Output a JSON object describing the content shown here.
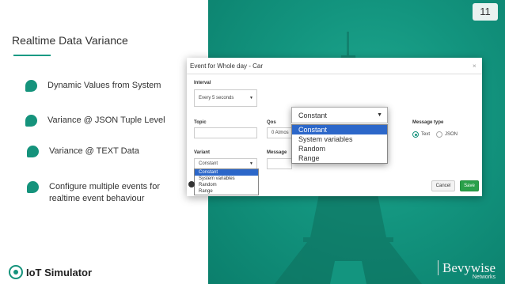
{
  "slide_number": "11",
  "title": "Realtime Data Variance",
  "bullets": [
    "Dynamic Values from System",
    "Variance @ JSON Tuple Level",
    "Variance @ TEXT Data",
    "Configure multiple events for",
    "realtime event behaviour"
  ],
  "footer": {
    "logo_text": "IoT Simulator",
    "brand_name": "Bevywise",
    "brand_sub": "Networks"
  },
  "modal": {
    "title": "Event for Whole day - Car",
    "close": "×",
    "interval_label": "Interval",
    "interval_value": "Every 5 seconds",
    "topic_label": "Topic",
    "qos_label": "Qos",
    "qos_value": "0 Atmos",
    "message_type_label": "Message type",
    "message_type_options": [
      "Text",
      "JSON"
    ],
    "message_type_selected": "Text",
    "variant_label": "Variant",
    "variant_value": "Constant",
    "message_label": "Message",
    "cancel_label": "Cancel",
    "save_label": "Save"
  },
  "variant_options": [
    "Constant",
    "System variables",
    "Random",
    "Range"
  ],
  "zoom_dropdown": {
    "value": "Constant",
    "options": [
      "Constant",
      "System variables",
      "Random",
      "Range"
    ],
    "selected": "Constant"
  },
  "colors": {
    "accent": "#15937c",
    "save": "#2aa04a",
    "selection": "#2c67c9"
  }
}
